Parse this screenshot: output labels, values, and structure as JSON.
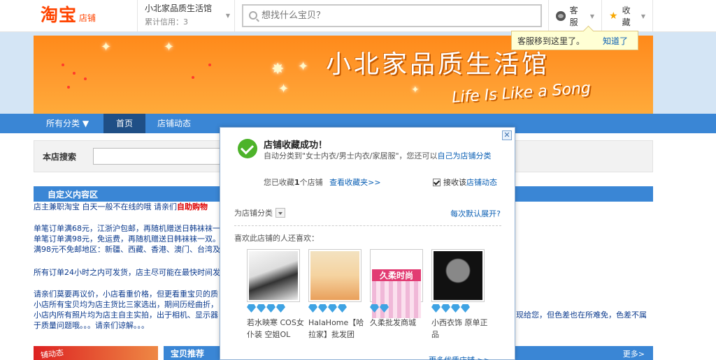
{
  "header": {
    "logo": "淘宝",
    "logo_sub": "店铺",
    "shop_name": "小北家品质生活馆",
    "shop_credit": "累计信用：3",
    "search_placeholder": "想找什么宝贝？",
    "service_label": "客服",
    "favorite_label": "收藏",
    "tip_text": "客服移到这里了。",
    "tip_link": "知道了"
  },
  "banner": {
    "title": "小北家品质生活馆",
    "subtitle": "Life Is Like a Song"
  },
  "nav": {
    "all_categories": "所有分类 ▼",
    "home": "首页",
    "shop_dynamics": "店铺动态"
  },
  "shop_search": {
    "label": "本店搜索"
  },
  "custom": {
    "heading": "自定义内容区",
    "lines": [
      "店主兼职淘宝  白天一般不在线的哦  请亲们",
      "自助购物",
      "单笔订单满68元，江浙沪包邮，再随机赠送日韩袜袜一",
      "单笔订单满98元，免运费，再随机赠送日韩袜袜一双。",
      "满98元不免邮地区：新疆、西藏、香港、澳门、台湾及",
      "所有订单24小时之内可发货，店主尽可能在最快时间发",
      "请亲们莫要再议价，小店看重价格，但更看重宝贝的质",
      "小店所有宝贝均为店主货比三家选出，期间历经曲折，",
      "小店内所有照片均为店主自主实拍，出于相机、显示器",
      "于质量问题哦。。。请亲们谅解。。。",
      "现给您，但色差也在所难免，色差不属"
    ]
  },
  "bottom": {
    "promo": "铺动态",
    "rec_title": "宝贝推荐",
    "rec_more": "更多>"
  },
  "popup": {
    "close": "✕",
    "title": "店铺收藏成功！",
    "desc_prefix": "自动分类到\"女士内衣/男士内衣/家居服\"，您还可以",
    "desc_link": "自己为店铺分类",
    "count_prefix": "您已收藏",
    "count_value": "1",
    "count_suffix": "个店铺",
    "view_favorites": "查看收藏夹>>",
    "receive_label": "接收该",
    "receive_link": "店铺动态",
    "category_label": "为店铺分类",
    "expand_question": "每次默认展开?",
    "like_title": "喜欢此店铺的人还喜欢：",
    "products": [
      {
        "name": "若水映寒 COS女仆装 空姐OL",
        "image": "model-photo",
        "gems": 4
      },
      {
        "name": "HalaHome【哈拉家】批发团",
        "image": "shop-banner",
        "gems": 4
      },
      {
        "name": "久柔批发商城",
        "image": "jiurou-banner",
        "image_text": "久柔时尚",
        "gems": 2
      },
      {
        "name": "小西衣饰 原单正品",
        "image": "portrait-photo",
        "gems": 4
      }
    ],
    "more_link": "更多优质店铺 >>"
  },
  "colors": {
    "brand": "#ff4400",
    "nav_blue": "#3a86d5",
    "banner_orange": "#ff8a1a"
  }
}
